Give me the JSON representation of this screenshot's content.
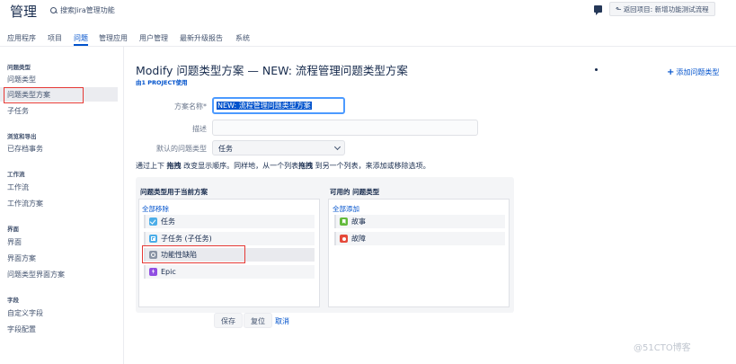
{
  "header": {
    "title": "管理",
    "search_placeholder": "搜索Jira管理功能",
    "back_button": "返回项目: 新增功能测试流程",
    "back_icon": "arrow-left-icon",
    "feedback_icon": "feedback-icon"
  },
  "nav": {
    "tabs": [
      {
        "label": "应用程序"
      },
      {
        "label": "项目"
      },
      {
        "label": "问题",
        "active": true
      },
      {
        "label": "管理应用"
      },
      {
        "label": "用户管理"
      },
      {
        "label": "最新升级报告"
      },
      {
        "label": "系统"
      }
    ]
  },
  "sidebar": {
    "sections": [
      {
        "title": "问题类型",
        "items": [
          "问题类型",
          "问题类型方案",
          "子任务"
        ]
      },
      {
        "title": "浏览和导出",
        "items": [
          "已存档事务"
        ]
      },
      {
        "title": "工作流",
        "items": [
          "工作流",
          "工作流方案"
        ]
      },
      {
        "title": "界面",
        "items": [
          "界面",
          "界面方案",
          "问题类型界面方案"
        ]
      },
      {
        "title": "字段",
        "items": [
          "自定义字段",
          "字段配置"
        ]
      }
    ],
    "selected": "问题类型方案"
  },
  "main": {
    "title": "Modify 问题类型方案 — NEW: 流程管理问题类型方案",
    "project_badge": "由1 PROJECT使用",
    "add_issue_type": "添加问题类型",
    "form": {
      "name_label": "方案名称*",
      "name_value": "NEW: 流程管理问题类型方案",
      "desc_label": "描述",
      "desc_value": "",
      "default_label": "默认的问题类型",
      "default_value": "任务"
    },
    "help": {
      "prefix": "通过上下",
      "drag1": "拖拽",
      "middle": "改变显示顺序。同样地，从一个列表",
      "drag2": "拖拽",
      "suffix": "到另一个列表，来添加或移除选项。"
    },
    "current_panel": {
      "title": "问题类型用于当前方案",
      "link": "全部移除",
      "items": [
        {
          "label": "任务",
          "icon": "task-icon"
        },
        {
          "label": "子任务 (子任务)",
          "icon": "subtask-icon"
        },
        {
          "label": "功能性缺陷",
          "icon": "feature-defect-icon"
        },
        {
          "label": "Epic",
          "icon": "epic-icon"
        }
      ]
    },
    "available_panel": {
      "title": "可用的 问题类型",
      "link": "全部添加",
      "items": [
        {
          "label": "故事",
          "icon": "story-icon"
        },
        {
          "label": "故障",
          "icon": "bug-icon"
        }
      ]
    },
    "buttons": {
      "save": "保存",
      "reset": "复位",
      "cancel": "取消"
    }
  },
  "watermark": "@51CTO博客",
  "colors": {
    "accent": "#0052cc",
    "highlight_box": "#e53935"
  }
}
